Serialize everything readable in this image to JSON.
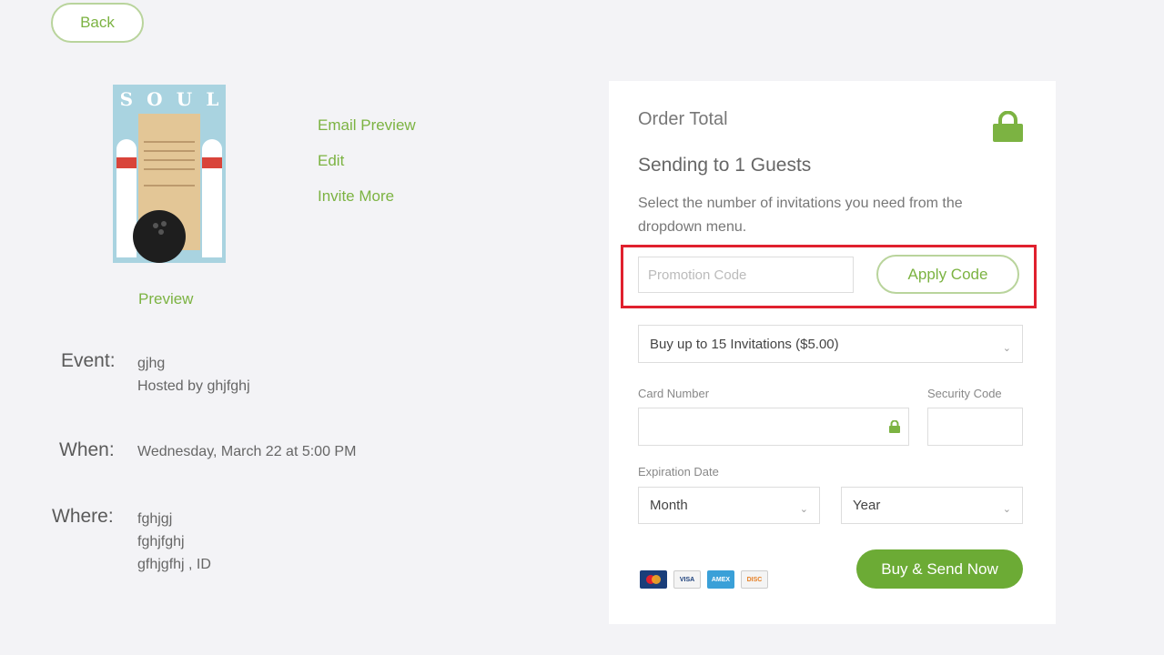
{
  "back_label": "Back",
  "thumbnail": {
    "letters": [
      "S",
      "O",
      "U",
      "L"
    ]
  },
  "preview_label": "Preview",
  "actions": {
    "email_preview": "Email Preview",
    "edit": "Edit",
    "invite_more": "Invite More"
  },
  "event": {
    "event_label": "Event:",
    "event_name": "gjhg",
    "hosted_by": "Hosted by ghjfghj",
    "when_label": "When:",
    "when_value": "Wednesday, March 22 at 5:00 PM",
    "where_label": "Where:",
    "where_lines": [
      "fghjgj",
      "fghjfghj",
      "gfhjgfhj ,  ID"
    ]
  },
  "order": {
    "title": "Order Total",
    "sending": "Sending to 1 Guests",
    "description": "Select the number of invitations you need from the dropdown menu.",
    "promo_placeholder": "Promotion Code",
    "apply_label": "Apply Code",
    "package_selected": "Buy up to 15 Invitations ($5.00)",
    "card_number_label": "Card Number",
    "security_code_label": "Security Code",
    "expiration_label": "Expiration Date",
    "month_selected": "Month",
    "year_selected": "Year",
    "buy_label": "Buy & Send Now",
    "card_brands": [
      "MasterCard",
      "VISA",
      "AMEX",
      "DISCOVER"
    ]
  },
  "colors": {
    "accent_green": "#7cb342",
    "button_green": "#6cab35",
    "highlight_red": "#e0202e",
    "background": "#f3f3f6"
  }
}
